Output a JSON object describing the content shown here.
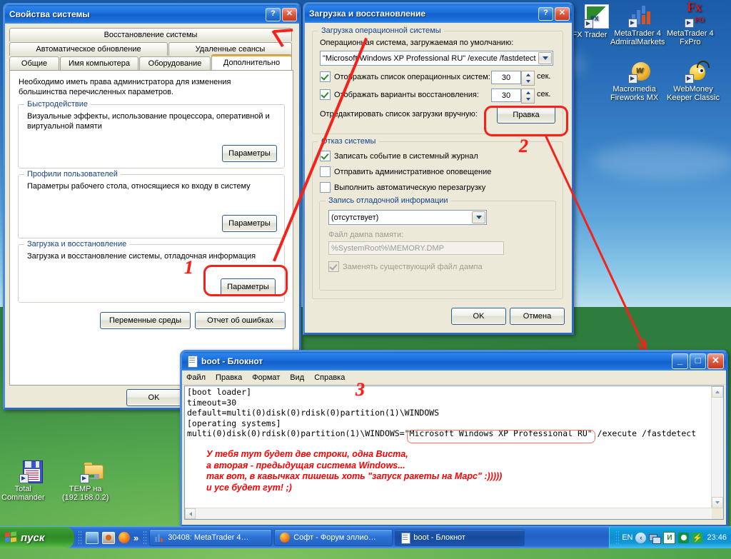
{
  "desktop": {
    "icons": [
      {
        "label": "stFX Trader",
        "name": "desktop-icon-bestfx-trader"
      },
      {
        "label": "MetaTrader 4\nAdmiralMarkets",
        "name": "desktop-icon-metatrader4-admiralmarkets"
      },
      {
        "label": "MetaTrader 4\nFxPro",
        "name": "desktop-icon-metatrader4-fxpro"
      },
      {
        "label": "Macromedia\nFireworks MX",
        "name": "desktop-icon-macromedia-fireworks-mx"
      },
      {
        "label": "WebMoney\nKeeper Classic",
        "name": "desktop-icon-webmoney-keeper-classic"
      },
      {
        "label": "Total\nCommander",
        "name": "desktop-icon-total-commander"
      },
      {
        "label": "TEMP на\n(192.168.0.2)",
        "name": "desktop-icon-temp-share"
      }
    ]
  },
  "system_properties": {
    "title": "Свойства системы",
    "help_btn": "?",
    "close_btn": "✕",
    "tabs_row1": [
      "Восстановление системы"
    ],
    "tabs_row2": [
      "Автоматическое обновление",
      "Удаленные сеансы"
    ],
    "tabs_row3": [
      "Общие",
      "Имя компьютера",
      "Оборудование",
      "Дополнительно"
    ],
    "active_tab": "Дополнительно",
    "intro_line1": "Необходимо иметь права администратора для изменения",
    "intro_line2": "большинства перечисленных параметров.",
    "groups": [
      {
        "caption": "Быстродействие",
        "desc_line1": "Визуальные эффекты, использование процессора, оперативной и",
        "desc_line2": "виртуальной памяти",
        "button": "Параметры"
      },
      {
        "caption": "Профили пользователей",
        "desc_line1": "Параметры рабочего стола, относящиеся ко входу в систему",
        "desc_line2": "",
        "button": "Параметры"
      },
      {
        "caption": "Загрузка и восстановление",
        "desc_line1": "Загрузка и восстановление системы, отладочная информация",
        "desc_line2": "",
        "button": "Параметры"
      }
    ],
    "env_button": "Переменные среды",
    "error_report_button": "Отчет об ошибках",
    "ok_button": "OK"
  },
  "startup_recovery": {
    "title": "Загрузка и восстановление",
    "help_btn": "?",
    "close_btn": "✕",
    "os_group_caption": "Загрузка операционной системы",
    "default_os_label": "Операционная система, загружаемая по умолчанию:",
    "default_os_value": "\"Microsoft Windows XP Professional RU\" /execute /fastdetect",
    "show_os_list_label": "Отображать список операционных систем:",
    "show_os_list_checked": true,
    "show_os_list_seconds": "30",
    "show_recovery_label": "Отображать варианты восстановления:",
    "show_recovery_checked": true,
    "show_recovery_seconds": "30",
    "seconds_unit": "сек.",
    "edit_boot_label": "Отредактировать список загрузки вручную:",
    "edit_button": "Правка",
    "failure_group_caption": "Отказ системы",
    "failure_options": [
      {
        "label": "Записать событие в системный журнал",
        "checked": true
      },
      {
        "label": "Отправить административное оповещение",
        "checked": false
      },
      {
        "label": "Выполнить автоматическую перезагрузку",
        "checked": false
      }
    ],
    "debug_group_caption": "Запись отладочной информации",
    "debug_value": "(отсутствует)",
    "dump_file_label": "Файл дампа памяти:",
    "dump_file_value": "%SystemRoot%\\MEMORY.DMP",
    "overwrite_label": "Заменять существующий файл дампа",
    "overwrite_checked": true,
    "ok_button": "OK",
    "cancel_button": "Отмена"
  },
  "notepad": {
    "title": "boot - Блокнот",
    "minimize_btn": "_",
    "maximize_btn": "□",
    "close_btn": "✕",
    "menu": [
      "Файл",
      "Правка",
      "Формат",
      "Вид",
      "Справка"
    ],
    "content_lines": [
      "[boot loader]",
      "timeout=30",
      "default=multi(0)disk(0)rdisk(0)partition(1)\\WINDOWS",
      "[operating systems]",
      "multi(0)disk(0)rdisk(0)partition(1)\\WINDOWS=\"Microsoft Windows XP Professional RU\" /execute /fastdetect"
    ],
    "highlighted_fragment": "\"Microsoft Windows XP Professional RU\"",
    "red_note": "У тебя тут будет две строки, одна Виста,\nа вторая - предыдущая система Windows...\nтак вот, в кавычках пишешь хоть \"запуск ракеты на Марс\" :)))))\nи усе будет гут! ;)"
  },
  "annotations": {
    "step1": "1",
    "step2": "2",
    "step3": "3",
    "accent_color": "#f4221b"
  },
  "taskbar": {
    "start_label": "пуск",
    "quick_launch": [
      "show-desktop-icon",
      "media-player-icon",
      "firefox-icon",
      "chevron-right-icon"
    ],
    "tasks": [
      {
        "label": "30408: MetaTrader 4…",
        "icon": "metatrader-icon",
        "active": false
      },
      {
        "label": "Софт - Форум эллио…",
        "icon": "firefox-icon",
        "active": false
      },
      {
        "label": "boot - Блокнот",
        "icon": "notepad-icon",
        "active": true
      }
    ],
    "tray": {
      "language": "EN",
      "icons": [
        "hide-tray-icon",
        "network-icon",
        "punto-switcher-icon",
        "disc-icon",
        "safely-remove-icon"
      ],
      "clock": "23:46"
    }
  }
}
